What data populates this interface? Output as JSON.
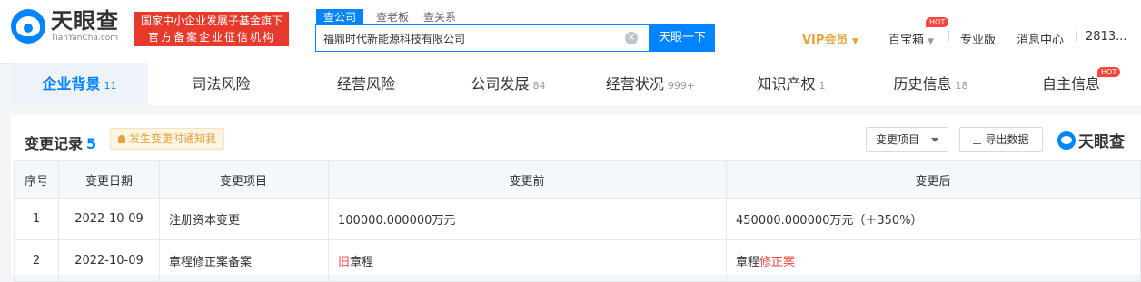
{
  "header": {
    "logo_cn": "天眼查",
    "logo_en": "TianYanCha.com",
    "gov_line1": "国家中小企业发展子基金旗下",
    "gov_line2": "官方备案企业征信机构",
    "search_tabs": [
      "查公司",
      "查老板",
      "查关系"
    ],
    "search_value": "福鼎时代新能源科技有限公司",
    "search_button": "天眼一下",
    "nav": {
      "vip": "VIP会员",
      "treasure": "百宝箱",
      "hot": "HOT",
      "pro": "专业版",
      "messages": "消息中心",
      "user": "2813..."
    }
  },
  "tabs": [
    {
      "label": "企业背景",
      "count": "11"
    },
    {
      "label": "司法风险",
      "count": ""
    },
    {
      "label": "经营风险",
      "count": ""
    },
    {
      "label": "公司发展",
      "count": "84"
    },
    {
      "label": "经营状况",
      "count": "999+"
    },
    {
      "label": "知识产权",
      "count": "1"
    },
    {
      "label": "历史信息",
      "count": "18"
    },
    {
      "label": "自主信息",
      "count": ""
    }
  ],
  "tab_hot": "HOT",
  "section": {
    "title": "变更记录",
    "count": "5",
    "notify_label": "发生变更时通知我",
    "select_label": "变更项目",
    "export_label": "导出数据",
    "brand": "天眼查"
  },
  "table": {
    "headers": [
      "序号",
      "变更日期",
      "变更项目",
      "变更前",
      "变更后"
    ],
    "rows": [
      {
        "idx": "1",
        "date": "2022-10-09",
        "item": "注册资本变更",
        "before": "100000.000000万元",
        "after": "450000.000000万元（＋350%）"
      },
      {
        "idx": "2",
        "date": "2022-10-09",
        "item": "章程修正案备案",
        "before_hl": "旧",
        "before": "章程",
        "after": "章程",
        "after_hl": "修正案"
      }
    ]
  }
}
